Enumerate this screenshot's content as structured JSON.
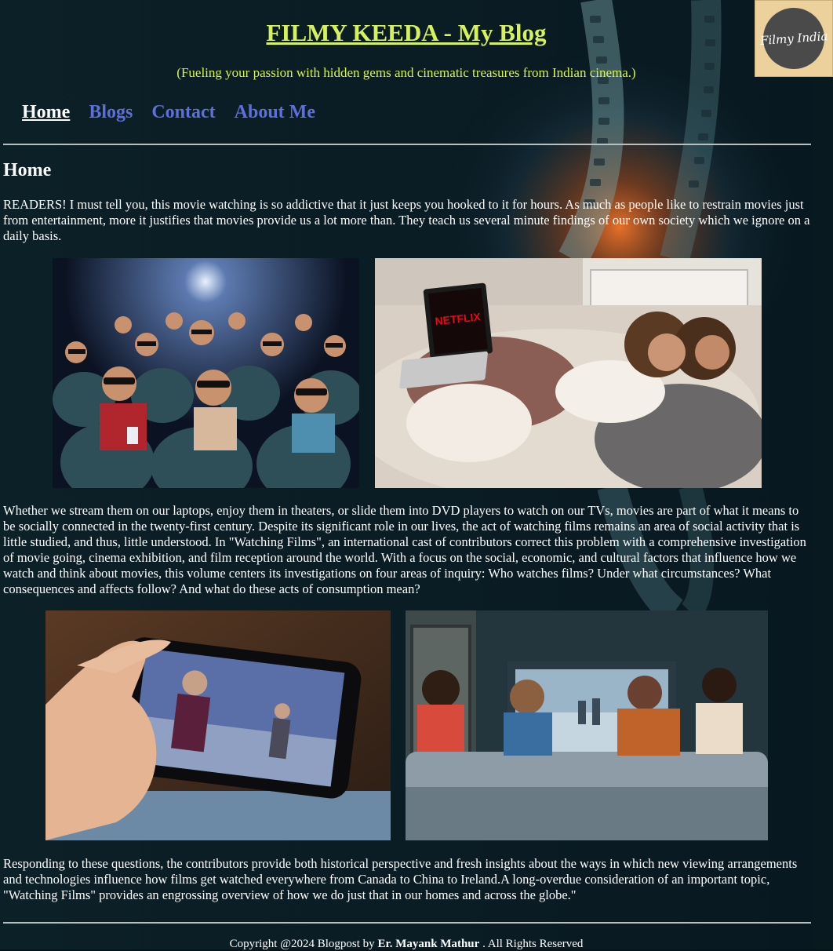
{
  "header": {
    "title": "FILMY KEEDA - My Blog",
    "tagline": "(Fueling your passion with hidden gems and cinematic treasures from Indian cinema.)",
    "logo_text": "Filmy India"
  },
  "nav": {
    "items": [
      {
        "label": "Home",
        "active": true
      },
      {
        "label": "Blogs",
        "active": false
      },
      {
        "label": "Contact",
        "active": false
      },
      {
        "label": "About Me",
        "active": false
      }
    ]
  },
  "main": {
    "heading": "Home",
    "paragraphs": [
      "READERS! I must tell you, this movie watching is so addictive that it just keeps you hooked to it for hours. As much as people like to restrain movies just from entertainment, more it justifies that movies provide us a lot more than. They teach us several minute findings of our own society which we ignore on a daily basis.",
      "Whether we stream them on our laptops, enjoy them in theaters, or slide them into DVD players to watch on our TVs, movies are part of what it means to be socially connected in the twenty-first century. Despite its significant role in our lives, the act of watching films remains an area of social activity that is little studied, and thus, little understood. In \"Watching Films\", an international cast of contributors correct this problem with a comprehensive investigation of movie going, cinema exhibition, and film reception around the world. With a focus on the social, economic, and cultural factors that influence how we watch and think about movies, this volume centers its investigations on four areas of inquiry: Who watches films? Under what circumstances? What consequences and affects follow? And what do these acts of consumption mean?",
      "Responding to these questions, the contributors provide both historical perspective and fresh insights about the ways in which new viewing arrangements and technologies influence how films get watched everywhere from Canada to China to Ireland.A long-overdue consideration of an important topic, \"Watching Films\" provides an engrossing overview of how we do just that in our homes and across the globe.\""
    ],
    "images": {
      "laptop_brand": "NETFLIX"
    }
  },
  "footer": {
    "prefix": "Copyright @2024 Blogpost by ",
    "author": "Er. Mayank Mathur",
    "suffix": " . All Rights Reserved"
  },
  "colors": {
    "title": "#d6f25a",
    "link": "#5d6fd8",
    "background": "#06141a"
  }
}
